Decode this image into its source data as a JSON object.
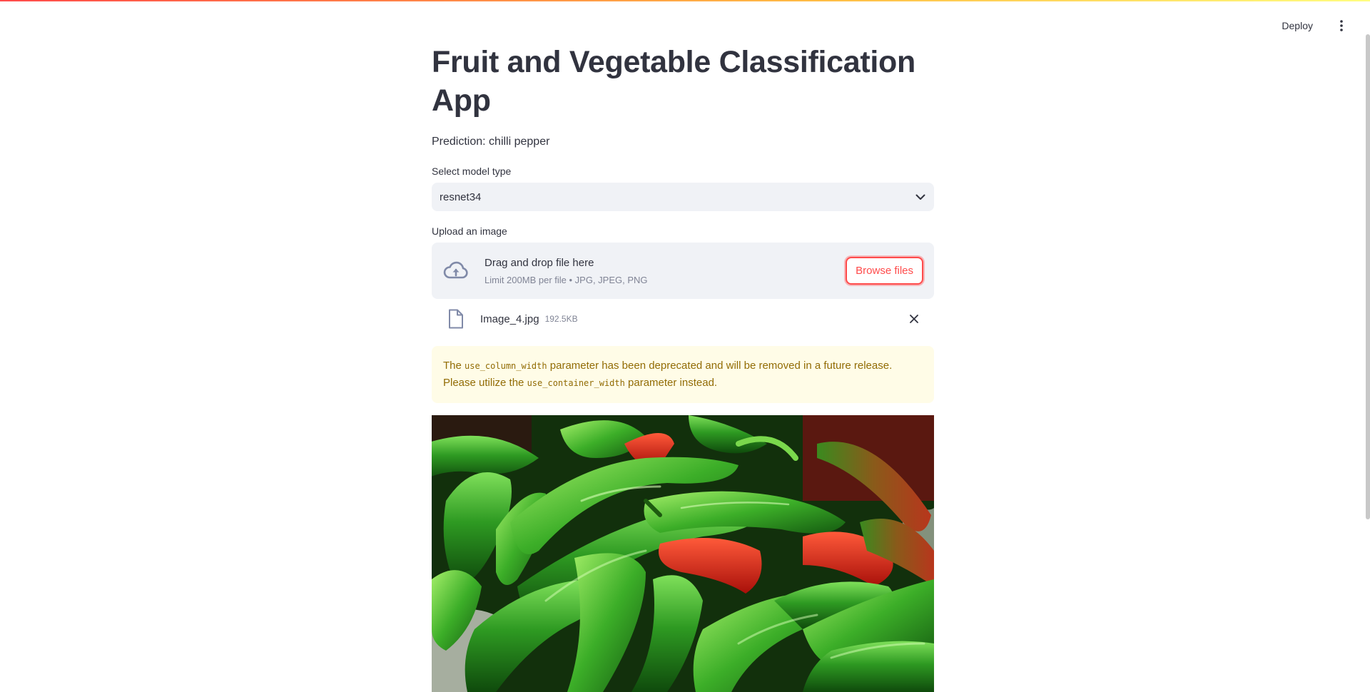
{
  "header": {
    "deploy_label": "Deploy",
    "menu_icon": "kebab-menu-icon"
  },
  "main": {
    "title": "Fruit and Vegetable Classification App",
    "prediction": "Prediction: chilli pepper",
    "model_select": {
      "label": "Select model type",
      "value": "resnet34",
      "icon": "chevron-down-icon"
    },
    "uploader": {
      "label": "Upload an image",
      "drop_title": "Drag and drop file here",
      "drop_subtitle": "Limit 200MB per file • JPG, JPEG, PNG",
      "browse_label": "Browse files",
      "icon": "cloud-upload-icon",
      "file": {
        "name": "Image_4.jpg",
        "size": "192.5KB",
        "icon": "file-icon",
        "remove_icon": "close-icon"
      }
    },
    "warning": {
      "text_1": "The ",
      "code_1": "use_column_width",
      "text_2": " parameter has been deprecated and will be removed in a future release. Please utilize the ",
      "code_2": "use_container_width",
      "text_3": " parameter instead."
    },
    "image": {
      "subject": "chilli peppers photo"
    }
  },
  "colors": {
    "primary": "#ff4b4b",
    "text": "#31333f",
    "widget_bg": "#f0f2f6",
    "warning_bg": "#fffce7",
    "warning_text": "#926c05"
  }
}
